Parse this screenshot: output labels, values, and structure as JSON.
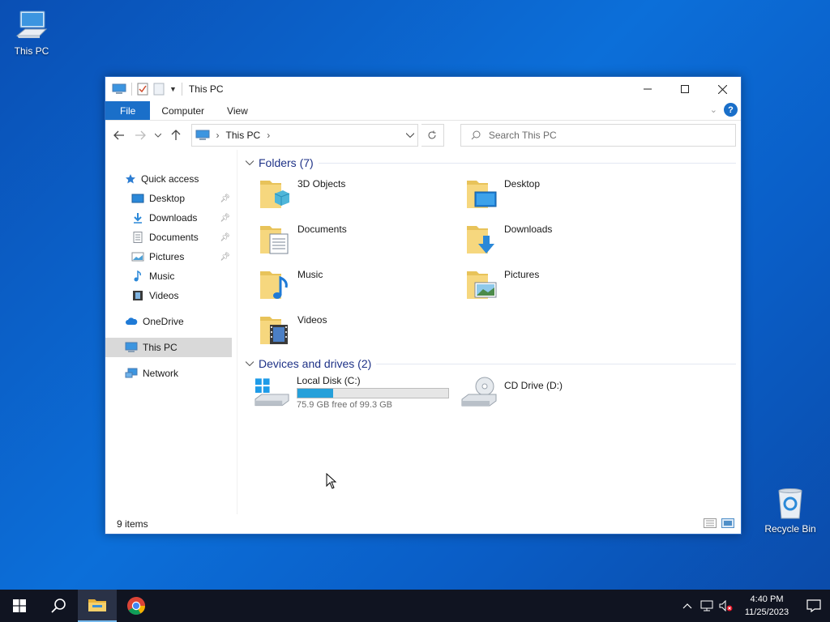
{
  "desktop": {
    "icons": [
      {
        "label": "This PC"
      },
      {
        "label": "Recycle Bin"
      }
    ]
  },
  "window": {
    "title": "This PC",
    "ribbon_tabs": [
      "File",
      "Computer",
      "View"
    ],
    "address": {
      "crumb": "This PC"
    },
    "search": {
      "placeholder": "Search This PC"
    },
    "sidebar": {
      "quick_access": "Quick access",
      "quick_items": [
        {
          "label": "Desktop",
          "icon": "desktop-icon",
          "pinned": true
        },
        {
          "label": "Downloads",
          "icon": "download-icon",
          "pinned": true
        },
        {
          "label": "Documents",
          "icon": "document-icon",
          "pinned": true
        },
        {
          "label": "Pictures",
          "icon": "picture-icon",
          "pinned": true
        },
        {
          "label": "Music",
          "icon": "music-icon",
          "pinned": false
        },
        {
          "label": "Videos",
          "icon": "video-icon",
          "pinned": false
        }
      ],
      "onedrive": "OneDrive",
      "this_pc": "This PC",
      "network": "Network"
    },
    "folders": {
      "header": "Folders (7)",
      "items": [
        "3D Objects",
        "Desktop",
        "Documents",
        "Downloads",
        "Music",
        "Pictures",
        "Videos"
      ]
    },
    "drives": {
      "header": "Devices and drives (2)",
      "local_disk": {
        "label": "Local Disk (C:)",
        "free": "75.9 GB free of 99.3 GB",
        "used_fraction": 0.236
      },
      "cd_drive": {
        "label": "CD Drive (D:)"
      }
    },
    "status": "9 items"
  },
  "taskbar": {
    "time": "4:40 PM",
    "date": "11/25/2023"
  },
  "colors": {
    "accent": "#1a6fc9",
    "drive_bar": "#26a0da",
    "group_header": "#1e3287"
  }
}
